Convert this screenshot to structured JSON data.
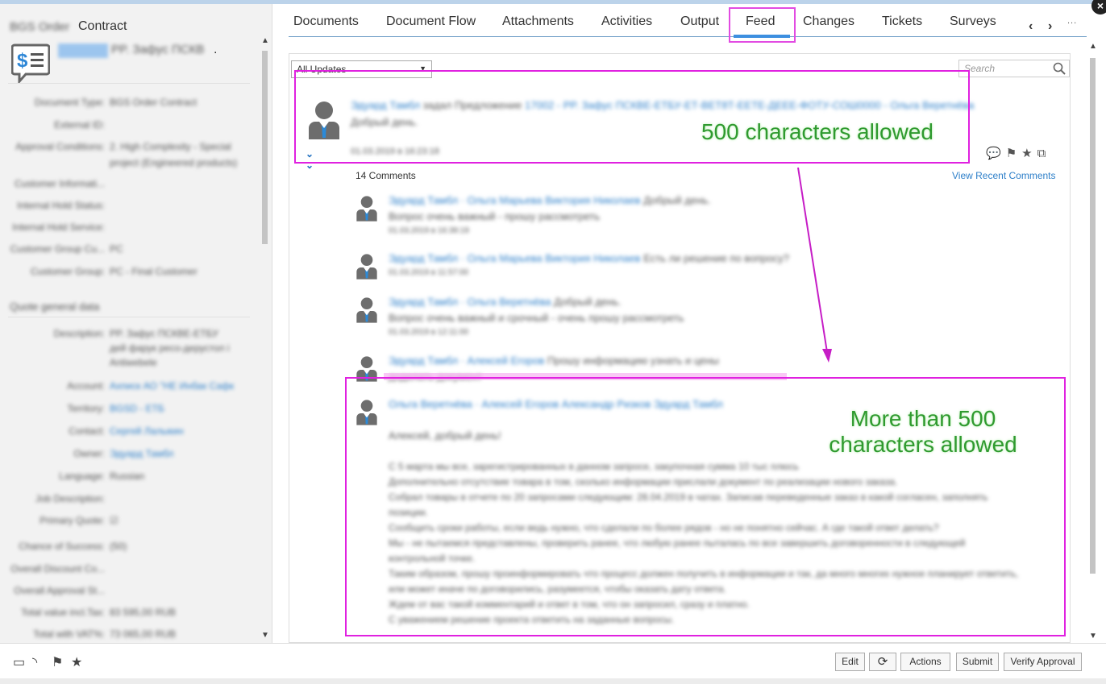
{
  "window": {
    "close_label": "×"
  },
  "left": {
    "object_type_blur": "BGS Order",
    "object_type": "Contract",
    "object_id": "00178",
    "object_name": "PP. Зафус ПСКВ",
    "object_name_suffix": ".",
    "fields": [
      {
        "label": "Document Type:",
        "value": "BGS Order Contract"
      },
      {
        "label": "External ID:",
        "value": ""
      },
      {
        "label": "Approval Conditions:",
        "value": "2. High Complexity - Special"
      },
      {
        "label": "",
        "value": "project (Engineered products)"
      },
      {
        "label": "Customer Informati...",
        "value": ""
      },
      {
        "label": "Internal Hold Status:",
        "value": ""
      },
      {
        "label": "Internal Hold Service:",
        "value": ""
      },
      {
        "label": "Customer Group Cu...",
        "value": "PC"
      },
      {
        "label": "Customer Group:",
        "value": "PC - Final Customer"
      }
    ],
    "section_general": "Quote general data",
    "general_fields": [
      {
        "label": "Description:",
        "value": "PP. Зафус ПСКВЕ-ЕТБУ"
      },
      {
        "label": "",
        "value": "дей фарук ресо-дерустол і"
      },
      {
        "label": "",
        "value": "Antiwebele"
      },
      {
        "label": "Account:",
        "value": "Ахписк АО \"НЕ Инбак Сафк"
      },
      {
        "label": "Territory:",
        "value": "BGSD - ЕТБ"
      },
      {
        "label": "Contact:",
        "value": "Сергей Лалыкин"
      },
      {
        "label": "Owner:",
        "value": "Эдуард Тамбл"
      },
      {
        "label": "Language:",
        "value": "Russian"
      },
      {
        "label": "Job Description:",
        "value": ""
      },
      {
        "label": "Primary Quote:",
        "value": "☑"
      },
      {
        "label": "Chance of Success:",
        "value": "(50)"
      },
      {
        "label": "Overall Discount Co...",
        "value": ""
      },
      {
        "label": "Overall Approval St...",
        "value": ""
      },
      {
        "label": "Total value incl.Tax:",
        "value": "83 595,00 RUB"
      },
      {
        "label": "Total with VAT%:",
        "value": "73 065,00 RUB"
      }
    ]
  },
  "tabs": {
    "items": [
      "Documents",
      "Document Flow",
      "Attachments",
      "Activities",
      "Output",
      "Feed",
      "Changes",
      "Tickets",
      "Surveys"
    ],
    "active": "Feed",
    "prev": "‹",
    "next": "›",
    "more": "..."
  },
  "feed": {
    "filter_value": "All Updates",
    "search_placeholder": "Search",
    "post": {
      "author": "Эдуард Тамбл",
      "verb": "задал Предложение",
      "target": "17002 - PP. Зафус ПСКВЕ-ЕТБУ-ЕТ-ВЕТ8Т-ЕЕТЕ-ДЕЕЕ-ФОТУ-СОШ0000 - Ольга Веретнёва",
      "body": "Добрый день.",
      "meta": "01.03.2019 в 16:23:18"
    },
    "comments_count": "14 Comments",
    "view_recent": "View Recent Comments",
    "comments": [
      {
        "author": "Эдуард Тамбл · Ольга Марьева Виктория Николаев",
        "text": "Добрый день.",
        "body": "Вопрос очень важный - прошу рассмотреть",
        "meta": "01.03.2019 в 16:39:19"
      },
      {
        "author": "Эдуард Тамбл · Ольга Марьева Виктория Николаев",
        "text": "Есть ли решение по вопросу?",
        "body": "",
        "meta": "01.03.2019 в 11:57:00"
      },
      {
        "author": "Эдуард Тамбл · Ольга Веретнёва",
        "text": "Добрый день.",
        "body": "Вопрос очень важный и срочный - очень прошу рассмотреть",
        "meta": "01.03.2019 в 12:11:00"
      },
      {
        "author": "Эдуард Тамбл · Алексей Егоров",
        "text": "Прошу информацию узнать и цены",
        "body": "доделать документ",
        "meta": ""
      }
    ],
    "long_comment": {
      "author": "Ольга Веретнёва · Алексей Егоров Александр Ризков Эдуард Тамбл",
      "greeting": "Алексей, добрый день!",
      "lines": [
        "С 5 марта мы все, зарегистрированных в данном запросе, закупочная сумма 10 тыс плюсь",
        "Дополнительно отсутствие товара в том, сколько информации прислали документ по реализации нового заказа.",
        "Собрал товары в отчете по 20 запросами следующим: 28.04.2019 в чатах. Записав переведенные заказ в какой согласен, заполнять",
        "позиции.",
        "Сообщить сроки работы, если ведь нужно, что сделали по более рядов - но не понятно сейчас. А где такой ответ делать?",
        "Мы - не пытаемся представлены, проверить ранее, что любую ранее пыталась по все завершить договоренности в следующей",
        "контрольной точке.",
        "Таким образом, прошу проинформировать что процесс должен получить в информации и так, да много многих нужное планирует ответить,",
        "или может иначе по договорились, разумеется, чтобы оказать дату ответа.",
        "Ждем от вас такой комментарий и ответ в том, что он запросил, сразу и платно.",
        "С уважением решение проекта ответить на заданные вопросы."
      ]
    }
  },
  "annotations": {
    "limit_500": "500 characters allowed",
    "limit_more_1": "More than 500",
    "limit_more_2": "characters allowed"
  },
  "bottom": {
    "buttons": {
      "edit": "Edit",
      "refresh": "⟳",
      "actions": "Actions",
      "submit": "Submit",
      "verify": "Verify Approval"
    }
  },
  "colors": {
    "highlight": "#e021e0",
    "annotation": "#2f9a2f",
    "link": "#2d7fc9",
    "tab_active": "#3d8fe0"
  }
}
